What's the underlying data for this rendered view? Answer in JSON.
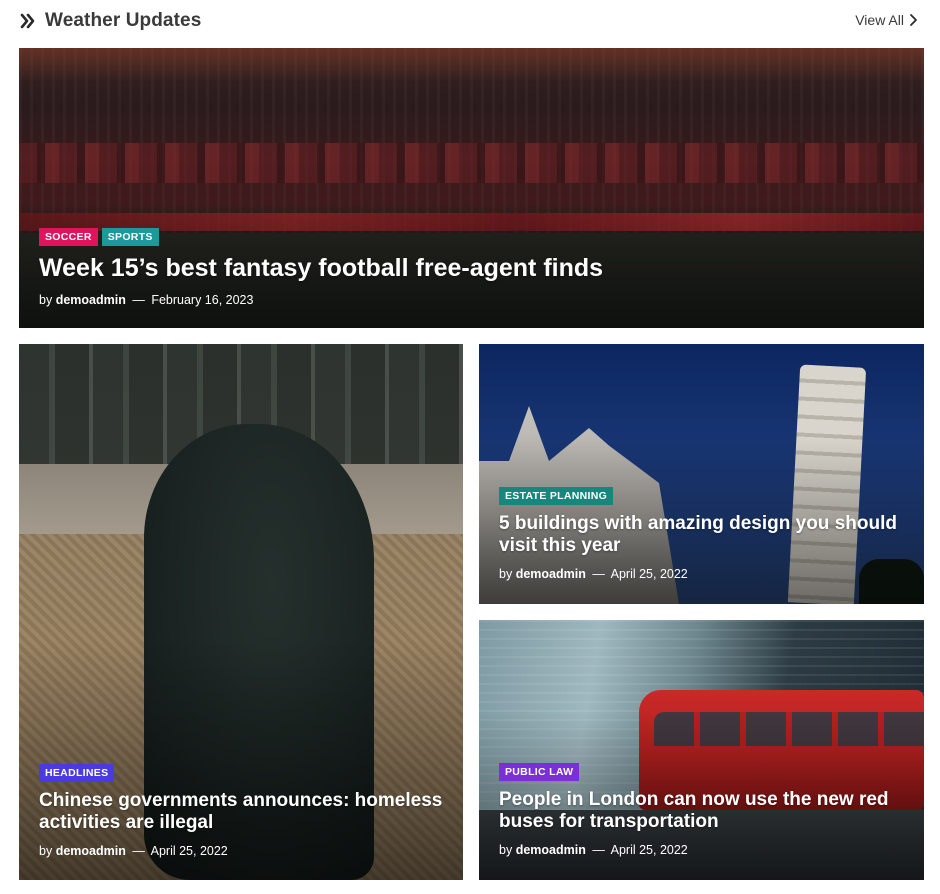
{
  "section": {
    "title": "Weather Updates",
    "title_icon": "double-chevron-right-icon",
    "view_all_label": "View All",
    "view_all_icon": "chevron-right-icon"
  },
  "posts": [
    {
      "tags": [
        {
          "label": "SOCCER",
          "color": "#e0135f"
        },
        {
          "label": "SPORTS",
          "color": "#1c9a9a"
        }
      ],
      "title": "Week 15’s best fantasy football free-agent finds",
      "by": "by",
      "author": "demoadmin",
      "separator": "—",
      "date": "February 16, 2023"
    },
    {
      "tags": [
        {
          "label": "HEADLINES",
          "color": "#4a3adf"
        }
      ],
      "title": "Chinese governments announces: homeless activities are illegal",
      "by": "by",
      "author": "demoadmin",
      "separator": "—",
      "date": "April 25, 2022"
    },
    {
      "tags": [
        {
          "label": "ESTATE PLANNING",
          "color": "#17867d"
        }
      ],
      "title": "5 buildings with amazing design you should visit this year",
      "by": "by",
      "author": "demoadmin",
      "separator": "—",
      "date": "April 25, 2022"
    },
    {
      "tags": [
        {
          "label": "PUBLIC LAW",
          "color": "#7b2fd6"
        }
      ],
      "title": "People in London can now use the new red buses for transportation",
      "by": "by",
      "author": "demoadmin",
      "separator": "—",
      "date": "April 25, 2022"
    }
  ]
}
